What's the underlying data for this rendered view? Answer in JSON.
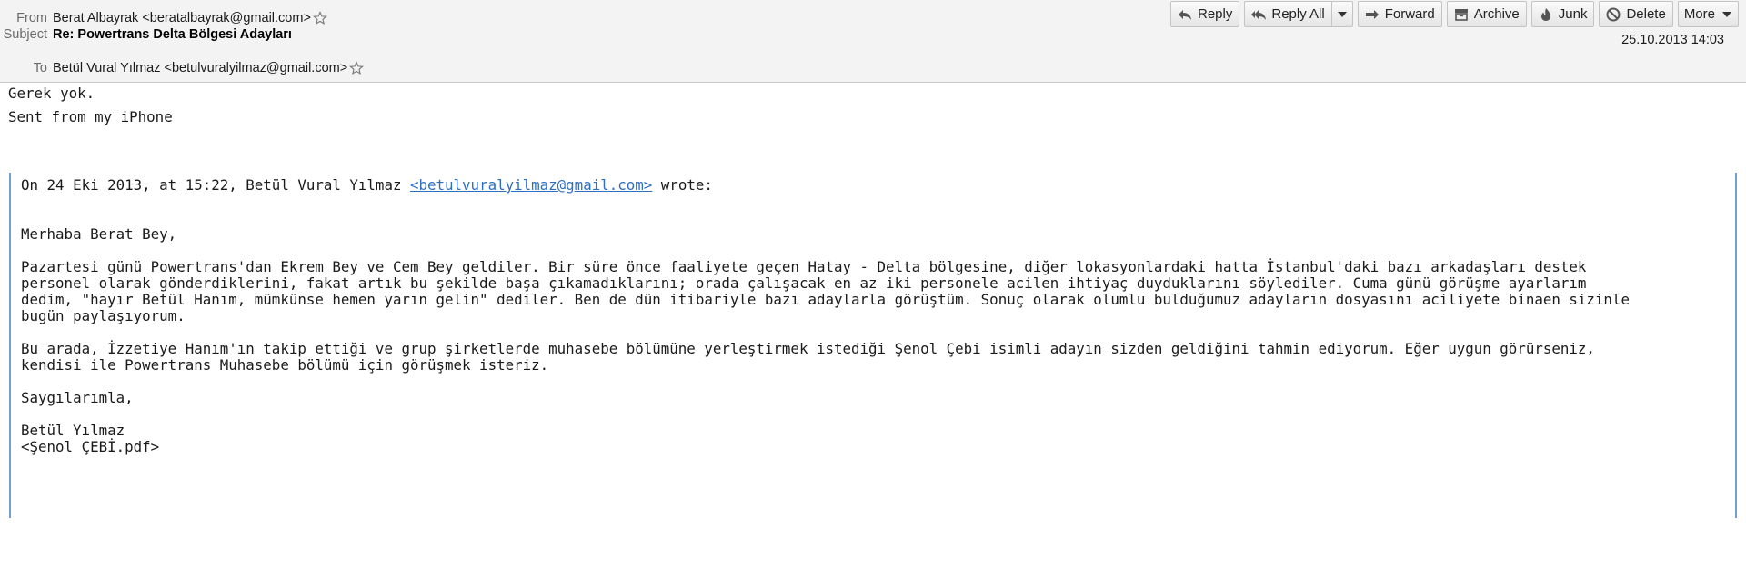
{
  "header": {
    "from_label": "From",
    "from_value": "Berat Albayrak <beratalbayrak@gmail.com>",
    "subject_label": "Subject",
    "subject_value": "Re: Powertrans Delta Bölgesi Adayları",
    "to_label": "To",
    "to_value": "Betül Vural Yılmaz <betulvuralyilmaz@gmail.com>",
    "date": "25.10.2013 14:03"
  },
  "toolbar": {
    "reply": "Reply",
    "reply_all": "Reply All",
    "forward": "Forward",
    "archive": "Archive",
    "junk": "Junk",
    "delete": "Delete",
    "more": "More"
  },
  "body": {
    "line1": "Gerek yok.",
    "line2": "Sent from my iPhone",
    "quote_intro_pre": "On 24 Eki 2013, at 15:22, Betül Vural Yılmaz ",
    "quote_intro_link": "<betulvuralyilmaz@gmail.com>",
    "quote_intro_post": " wrote:",
    "greeting": "Merhaba Berat Bey,",
    "p1_l1": "Pazartesi günü Powertrans'dan Ekrem Bey ve Cem Bey geldiler. Bir süre önce faaliyete geçen Hatay - Delta bölgesine, diğer lokasyonlardaki hatta İstanbul'daki bazı arkadaşları destek",
    "p1_l2": "personel olarak gönderdiklerini, fakat artık bu şekilde başa çıkamadıklarını; orada çalışacak en az iki personele acilen ihtiyaç duyduklarını söylediler. Cuma günü görüşme ayarlarım",
    "p1_l3": "dedim, \"hayır Betül Hanım, mümkünse hemen yarın gelin\" dediler. Ben de dün itibariyle bazı adaylarla görüştüm. Sonuç olarak olumlu bulduğumuz adayların dosyasını aciliyete binaen sizinle",
    "p1_l4": "bugün paylaşıyorum.",
    "p2_l1": "Bu arada, İzzetiye Hanım'ın takip ettiği ve grup şirketlerde muhasebe bölümüne yerleştirmek istediği Şenol Çebi isimli adayın sizden geldiğini tahmin ediyorum. Eğer uygun görürseniz,",
    "p2_l2": "kendisi ile Powertrans Muhasebe bölümü için görüşmek isteriz.",
    "closing": "Saygılarımla,",
    "signature": "Betül Yılmaz",
    "attachment": "<Şenol ÇEBİ.pdf>"
  },
  "colors": {
    "header_bg": "#f3f3f3",
    "quote_bar": "#729fcf",
    "link": "#2e6fc2"
  }
}
